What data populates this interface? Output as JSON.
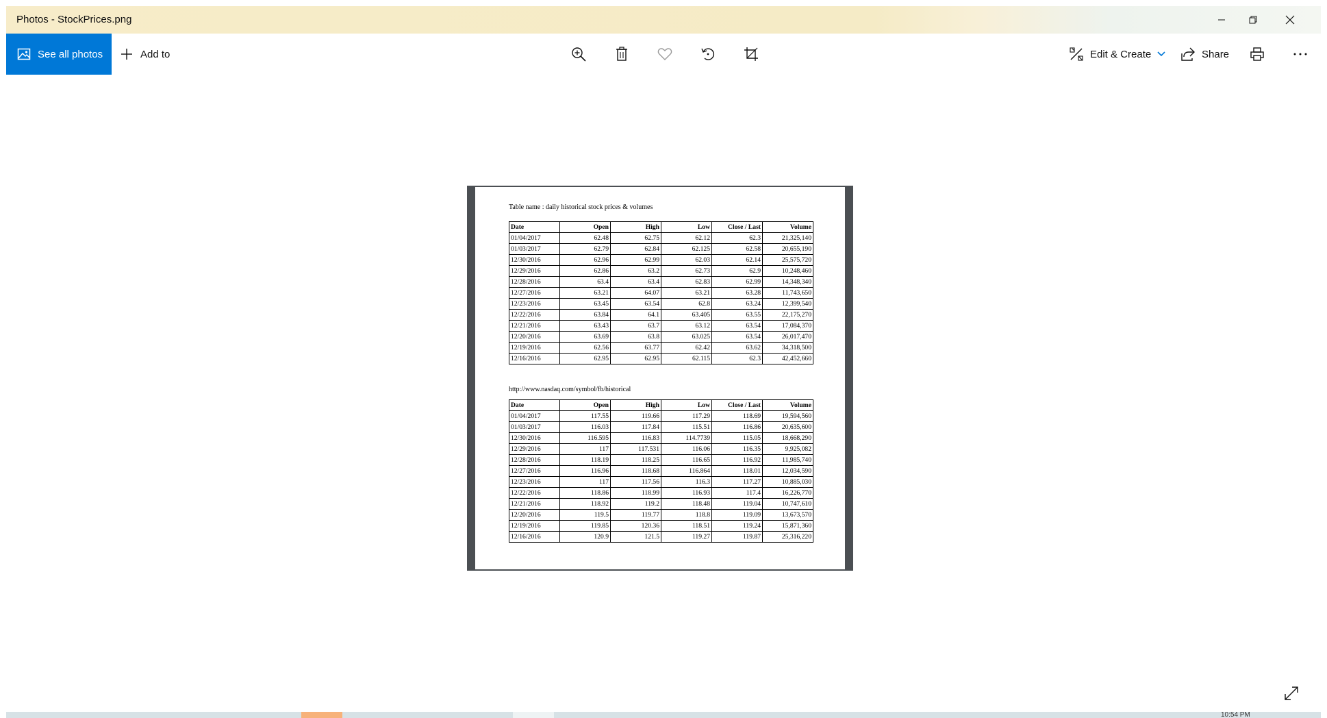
{
  "window": {
    "title": "Photos - StockPrices.png"
  },
  "toolbar": {
    "see_all_photos": "See all photos",
    "add_to": "Add to",
    "edit_create": "Edit & Create",
    "share": "Share",
    "icons": [
      "photos-icon",
      "plus-icon",
      "zoom-in-icon",
      "delete-icon",
      "heart-icon",
      "rotate-icon",
      "crop-icon",
      "edit-create-icon",
      "chevron-down-icon",
      "share-icon",
      "print-icon",
      "more-icon"
    ]
  },
  "document": {
    "caption": "Table name : daily historical stock prices & volumes",
    "source_url": "http://www.nasdaq.com/symbol/fb/historical",
    "columns": [
      "Date",
      "Open",
      "High",
      "Low",
      "Close / Last",
      "Volume"
    ],
    "table1": [
      [
        "01/04/2017",
        "62.48",
        "62.75",
        "62.12",
        "62.3",
        "21,325,140"
      ],
      [
        "01/03/2017",
        "62.79",
        "62.84",
        "62.125",
        "62.58",
        "20,655,190"
      ],
      [
        "12/30/2016",
        "62.96",
        "62.99",
        "62.03",
        "62.14",
        "25,575,720"
      ],
      [
        "12/29/2016",
        "62.86",
        "63.2",
        "62.73",
        "62.9",
        "10,248,460"
      ],
      [
        "12/28/2016",
        "63.4",
        "63.4",
        "62.83",
        "62.99",
        "14,348,340"
      ],
      [
        "12/27/2016",
        "63.21",
        "64.07",
        "63.21",
        "63.28",
        "11,743,650"
      ],
      [
        "12/23/2016",
        "63.45",
        "63.54",
        "62.8",
        "63.24",
        "12,399,540"
      ],
      [
        "12/22/2016",
        "63.84",
        "64.1",
        "63.405",
        "63.55",
        "22,175,270"
      ],
      [
        "12/21/2016",
        "63.43",
        "63.7",
        "63.12",
        "63.54",
        "17,084,370"
      ],
      [
        "12/20/2016",
        "63.69",
        "63.8",
        "63.025",
        "63.54",
        "26,017,470"
      ],
      [
        "12/19/2016",
        "62.56",
        "63.77",
        "62.42",
        "63.62",
        "34,318,500"
      ],
      [
        "12/16/2016",
        "62.95",
        "62.95",
        "62.115",
        "62.3",
        "42,452,660"
      ]
    ],
    "table2": [
      [
        "01/04/2017",
        "117.55",
        "119.66",
        "117.29",
        "118.69",
        "19,594,560"
      ],
      [
        "01/03/2017",
        "116.03",
        "117.84",
        "115.51",
        "116.86",
        "20,635,600"
      ],
      [
        "12/30/2016",
        "116.595",
        "116.83",
        "114.7739",
        "115.05",
        "18,668,290"
      ],
      [
        "12/29/2016",
        "117",
        "117.531",
        "116.06",
        "116.35",
        "9,925,082"
      ],
      [
        "12/28/2016",
        "118.19",
        "118.25",
        "116.65",
        "116.92",
        "11,985,740"
      ],
      [
        "12/27/2016",
        "116.96",
        "118.68",
        "116.864",
        "118.01",
        "12,034,590"
      ],
      [
        "12/23/2016",
        "117",
        "117.56",
        "116.3",
        "117.27",
        "10,885,030"
      ],
      [
        "12/22/2016",
        "118.86",
        "118.99",
        "116.93",
        "117.4",
        "16,226,770"
      ],
      [
        "12/21/2016",
        "118.92",
        "119.2",
        "118.48",
        "119.04",
        "10,747,610"
      ],
      [
        "12/20/2016",
        "119.5",
        "119.77",
        "118.8",
        "119.09",
        "13,673,570"
      ],
      [
        "12/19/2016",
        "119.85",
        "120.36",
        "118.51",
        "119.24",
        "15,871,360"
      ],
      [
        "12/16/2016",
        "120.9",
        "121.5",
        "119.27",
        "119.87",
        "25,316,220"
      ]
    ]
  },
  "taskbar": {
    "clock": "10:54 PM"
  },
  "colors": {
    "accent": "#0078d7",
    "frame": "#4b4f53",
    "taskbar_highlight": "#f7b27a"
  }
}
